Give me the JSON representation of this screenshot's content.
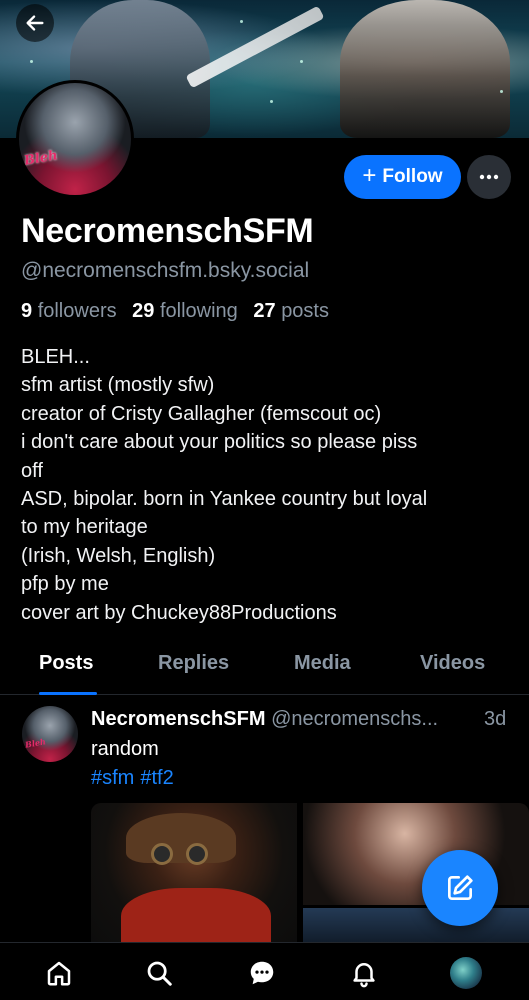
{
  "profile": {
    "display_name": "NecromenschSFM",
    "handle": "@necromenschsfm.bsky.social",
    "followers_count": "9",
    "followers_label": "followers",
    "following_count": "29",
    "following_label": "following",
    "posts_count": "27",
    "posts_label": "posts",
    "avatar_text": "Bleh",
    "bio_lines": [
      "BLEH...",
      "sfm artist (mostly sfw)",
      "creator of Cristy Gallagher (femscout oc)",
      "i don't care about your politics so please piss",
      "off",
      "ASD, bipolar. born in Yankee country but loyal",
      "to my heritage",
      "(Irish, Welsh, English)",
      "pfp by me",
      "cover art by Chuckey88Productions"
    ]
  },
  "actions": {
    "follow_label": "Follow",
    "follow_icon": "plus-icon",
    "more_icon": "ellipsis-icon",
    "back_icon": "arrow-left-icon"
  },
  "tabs": [
    {
      "label": "Posts",
      "active": true
    },
    {
      "label": "Replies",
      "active": false
    },
    {
      "label": "Media",
      "active": false
    },
    {
      "label": "Videos",
      "active": false
    }
  ],
  "post": {
    "author_name": "NecromenschSFM",
    "author_handle": "@necromenschs...",
    "time": "3d",
    "text": "random",
    "tags": [
      "#sfm",
      "#tf2"
    ]
  },
  "fab_icon": "compose-icon",
  "bottom_nav": [
    "home-icon",
    "search-icon",
    "chat-icon",
    "bell-icon",
    "profile-avatar"
  ],
  "colors": {
    "accent": "#0a73ff",
    "link": "#1a85ff",
    "muted_text": "#8a96a3",
    "background": "#000000"
  }
}
